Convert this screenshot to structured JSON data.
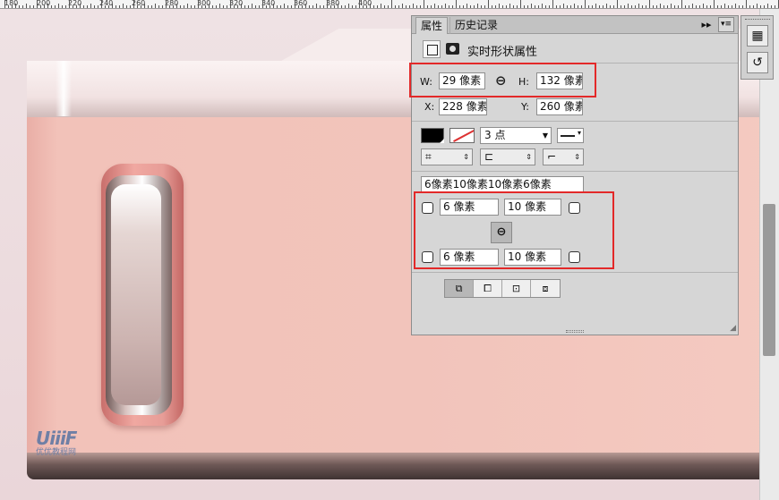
{
  "ruler": {
    "labels": [
      "180",
      "200",
      "220",
      "240",
      "260",
      "280",
      "300",
      "320",
      "340",
      "360",
      "380",
      "400"
    ]
  },
  "watermark": {
    "mark": "UiiiF",
    "text": "优优教程网"
  },
  "panel": {
    "tabs": [
      "属性",
      "历史记录"
    ],
    "collapse_glyph": "▸▸",
    "menu_glyph": "▾≡",
    "title": "实时形状属性",
    "size": {
      "w_label": "W:",
      "w_value": "29 像素",
      "h_label": "H:",
      "h_value": "132 像素"
    },
    "position": {
      "x_label": "X:",
      "x_value": "228 像素",
      "y_label": "Y:",
      "y_value": "260 像素"
    },
    "stroke": {
      "width_value": "3 点"
    },
    "corners_summary": "6像素10像素10像素6像素",
    "corners": {
      "top_left": "6 像素",
      "top_right": "10 像素",
      "bottom_left": "6 像素",
      "bottom_right": "10 像素"
    },
    "link_glyph": "⊖"
  },
  "colors": {
    "highlight": "#e32929",
    "fill": "#000000",
    "stroke": "#dd3333"
  }
}
